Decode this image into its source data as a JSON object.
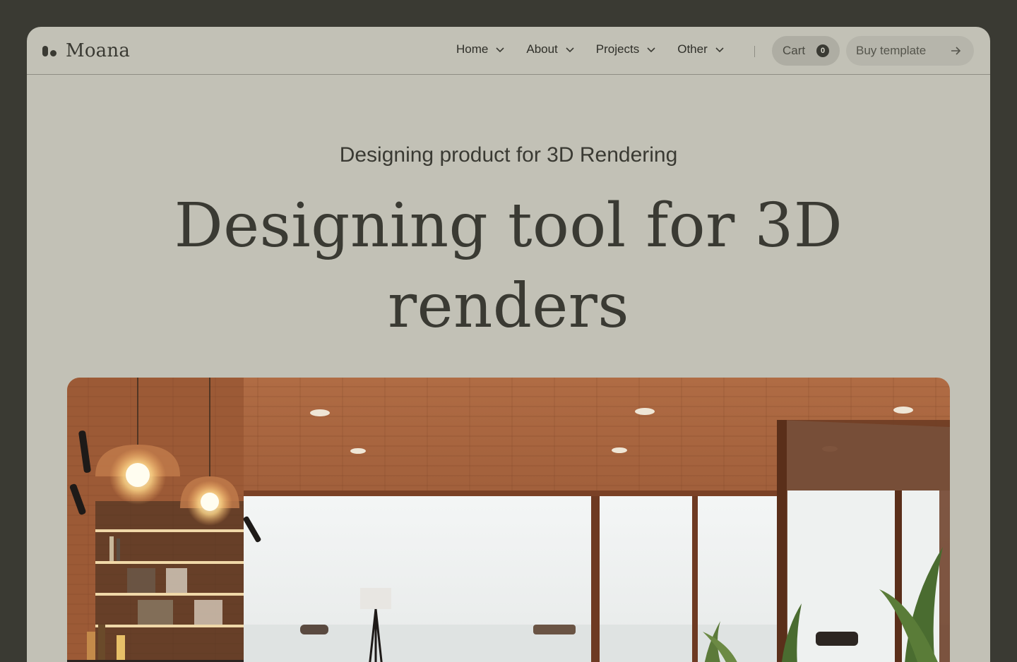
{
  "brand": {
    "name": "Moana"
  },
  "nav": {
    "items": [
      {
        "label": "Home",
        "icon": "chevron-down-icon"
      },
      {
        "label": "About",
        "icon": "chevron-down-icon"
      },
      {
        "label": "Projects",
        "icon": "chevron-down-icon"
      },
      {
        "label": "Other",
        "icon": "chevron-down-icon"
      }
    ],
    "cart": {
      "label": "Cart",
      "count": "0"
    },
    "buy": {
      "label": "Buy template",
      "icon": "arrow-right-icon"
    }
  },
  "hero": {
    "eyebrow": "Designing product for 3D Rendering",
    "title": "Designing tool for 3D renders",
    "image": {
      "icon": "interior-render-photo"
    }
  },
  "colors": {
    "page_bg": "#3a3a33",
    "frame_bg": "#c2c1b6",
    "text": "#3a3a33",
    "wood": "#a0603c"
  }
}
